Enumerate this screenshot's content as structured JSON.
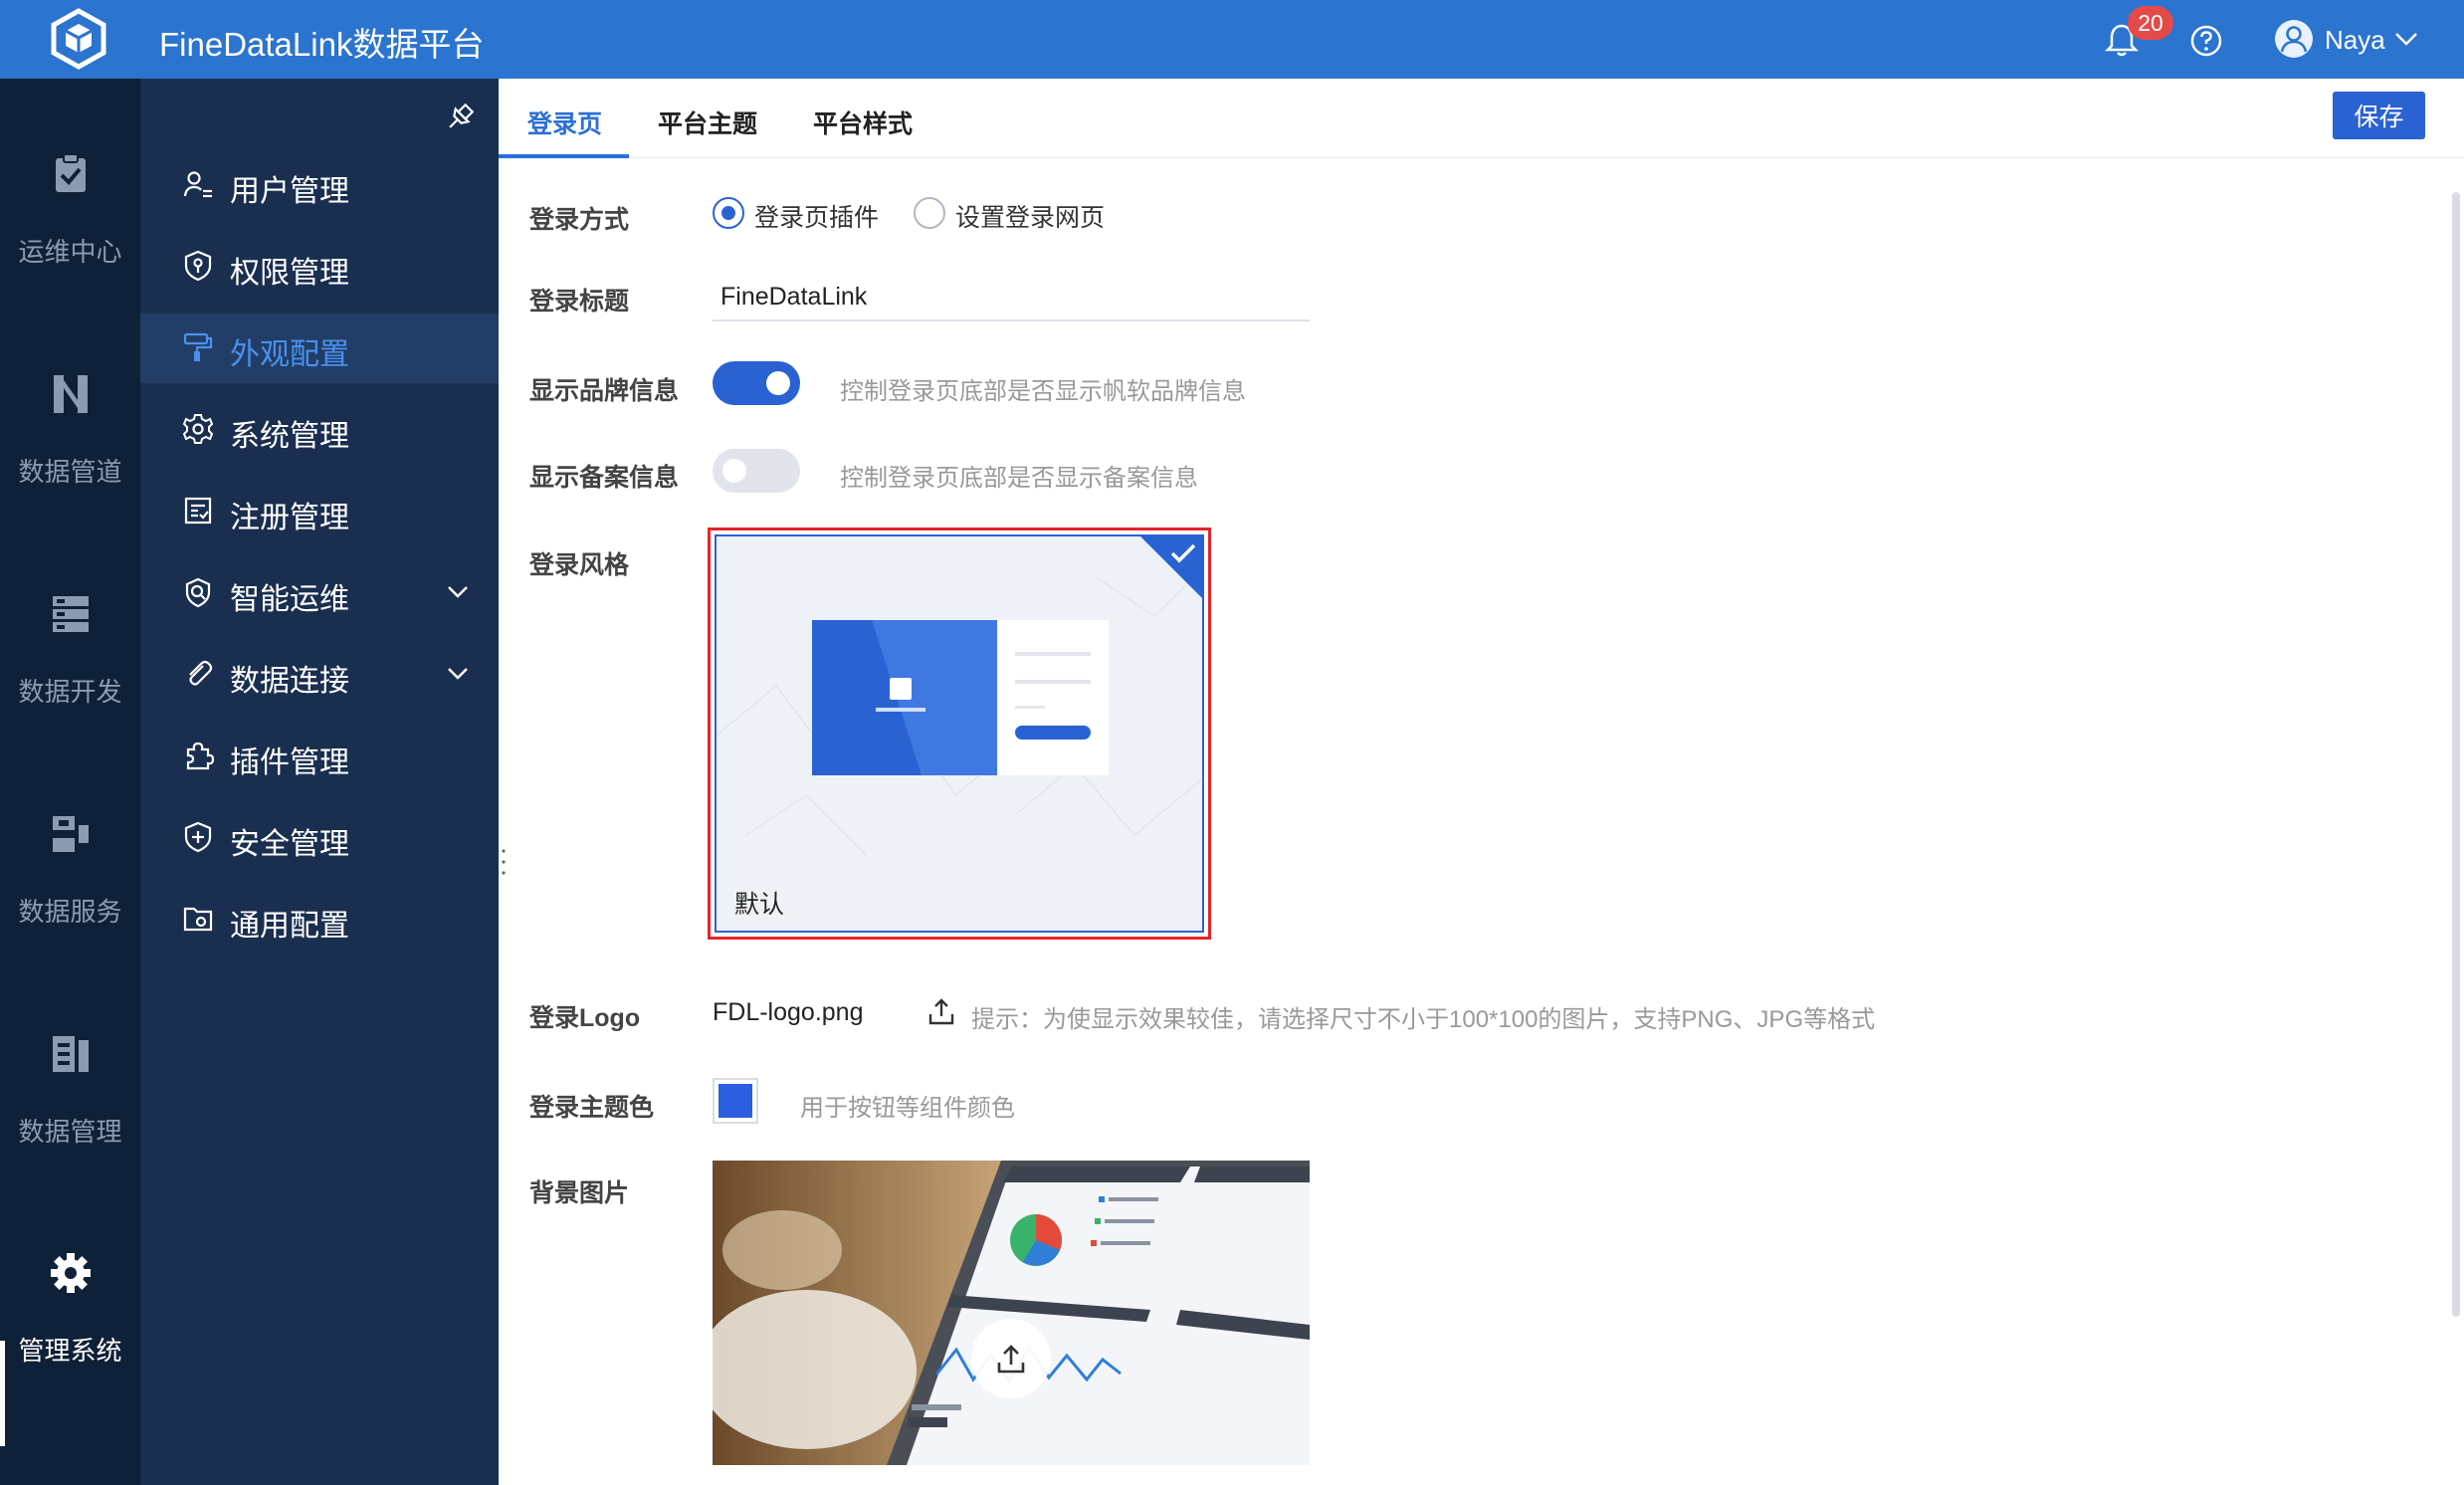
{
  "header": {
    "app_title": "FineDataLink数据平台",
    "notification_count": "20",
    "user_name": "Naya"
  },
  "rail": {
    "items": [
      {
        "label": "运维中心",
        "icon": "clipboard-check-icon"
      },
      {
        "label": "数据管道",
        "icon": "pipeline-icon"
      },
      {
        "label": "数据开发",
        "icon": "server-stack-icon"
      },
      {
        "label": "数据服务",
        "icon": "api-service-icon"
      },
      {
        "label": "数据管理",
        "icon": "data-management-icon"
      },
      {
        "label": "管理系统",
        "icon": "gear-icon",
        "active": true
      }
    ]
  },
  "menu": {
    "items": [
      {
        "label": "用户管理",
        "icon": "user-list-icon"
      },
      {
        "label": "权限管理",
        "icon": "shield-key-icon"
      },
      {
        "label": "外观配置",
        "icon": "paint-roller-icon",
        "active": true
      },
      {
        "label": "系统管理",
        "icon": "gear-icon"
      },
      {
        "label": "注册管理",
        "icon": "register-icon"
      },
      {
        "label": "智能运维",
        "icon": "smart-ops-icon",
        "expandable": true
      },
      {
        "label": "数据连接",
        "icon": "paperclip-icon",
        "expandable": true
      },
      {
        "label": "插件管理",
        "icon": "puzzle-icon"
      },
      {
        "label": "安全管理",
        "icon": "shield-plus-icon"
      },
      {
        "label": "通用配置",
        "icon": "folder-gear-icon"
      }
    ]
  },
  "tabs": [
    {
      "label": "登录页",
      "active": true
    },
    {
      "label": "平台主题"
    },
    {
      "label": "平台样式"
    }
  ],
  "toolbar": {
    "save_label": "保存"
  },
  "form": {
    "login_method": {
      "label": "登录方式",
      "options": [
        "登录页插件",
        "设置登录网页"
      ],
      "selected": "登录页插件"
    },
    "login_title": {
      "label": "登录标题",
      "value": "FineDataLink"
    },
    "show_brand": {
      "label": "显示品牌信息",
      "on": true,
      "hint": "控制登录页底部是否显示帆软品牌信息"
    },
    "show_record": {
      "label": "显示备案信息",
      "on": false,
      "hint": "控制登录页底部是否显示备案信息"
    },
    "login_style": {
      "label": "登录风格",
      "card_label": "默认"
    },
    "login_logo": {
      "label": "登录Logo",
      "file": "FDL-logo.png",
      "hint": "提示：为使显示效果较佳，请选择尺寸不小于100*100的图片，支持PNG、JPG等格式"
    },
    "theme_color": {
      "label": "登录主题色",
      "color": "#2b5ee0",
      "hint": "用于按钮等组件颜色"
    },
    "background": {
      "label": "背景图片"
    }
  }
}
